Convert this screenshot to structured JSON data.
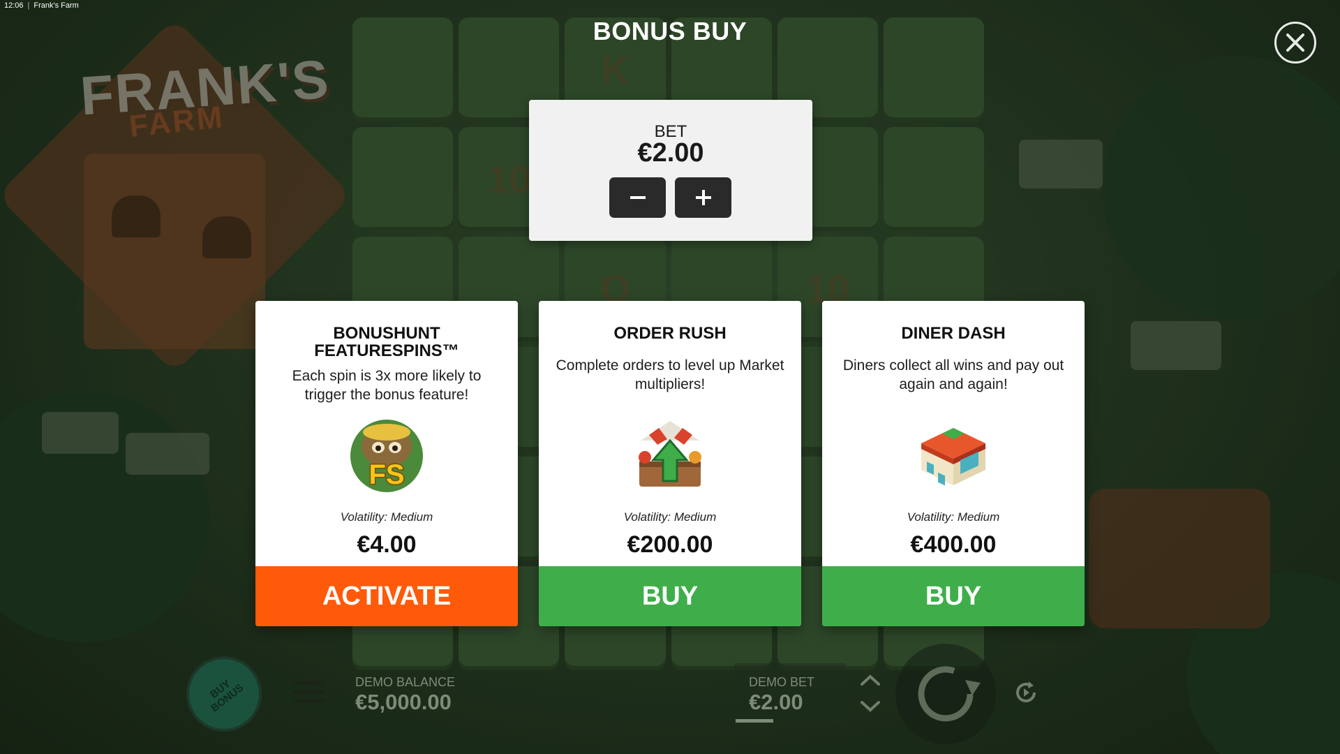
{
  "status_bar": {
    "time": "12:06",
    "app_title": "Frank's Farm"
  },
  "logo": {
    "main": "FRANK'S",
    "sub": "FARM"
  },
  "header": {
    "title": "BONUS BUY"
  },
  "bet": {
    "label": "BET",
    "value": "€2.00"
  },
  "cards": [
    {
      "title_line1": "BONUSHUNT",
      "title_line2": "FEATURESPINS™",
      "description": "Each spin is 3x more likely to trigger the bonus feature!",
      "badge_text": "FS",
      "volatility": "Volatility: Medium",
      "price": "€4.00",
      "action": "ACTIVATE"
    },
    {
      "title_line1": "ORDER RUSH",
      "description": "Complete orders to level up Market multipliers!",
      "volatility": "Volatility: Medium",
      "price": "€200.00",
      "action": "BUY"
    },
    {
      "title_line1": "DINER DASH",
      "description": "Diners collect all wins and pay out again and again!",
      "volatility": "Volatility: Medium",
      "price": "€400.00",
      "action": "BUY"
    }
  ],
  "bottom_bar": {
    "buy_bonus_line1": "BUY",
    "buy_bonus_line2": "BONUS",
    "demo_balance_label": "DEMO BALANCE",
    "demo_balance_value": "€5,000.00",
    "demo_bet_label": "DEMO BET",
    "demo_bet_value": "€2.00"
  },
  "background_reel": [
    "",
    "",
    "K",
    "",
    "",
    "",
    "",
    "10",
    "",
    "",
    "",
    "",
    "",
    "",
    "Q",
    "",
    "10",
    "",
    "",
    "",
    "",
    "",
    "",
    "",
    "",
    "",
    "",
    "",
    "",
    "",
    "",
    "",
    "",
    "",
    "",
    ""
  ],
  "colors": {
    "activate": "#ff5a0a",
    "buy": "#3fae4a",
    "panel": "#ffffff",
    "bet_panel": "#f1f1f1"
  },
  "icons": {
    "close": "close-icon",
    "minus": "minus-icon",
    "plus": "plus-icon",
    "menu": "hamburger-menu-icon",
    "spin": "spin-icon",
    "autoplay": "autoplay-icon",
    "up": "chevron-up-icon",
    "down": "chevron-down-icon"
  }
}
